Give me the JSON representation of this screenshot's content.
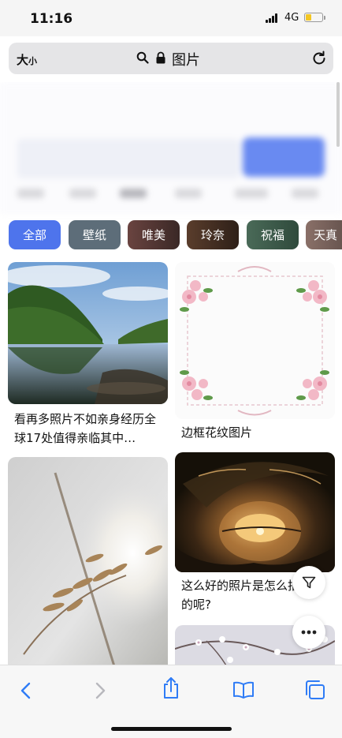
{
  "status_bar": {
    "time": "11:16",
    "network": "4G",
    "battery_level": 0.3
  },
  "url_bar": {
    "text_size_big": "大",
    "text_size_small": "小",
    "url": "图片"
  },
  "categories": [
    {
      "label": "全部",
      "selected": true,
      "color": "#4e74ec"
    },
    {
      "label": "壁纸",
      "selected": false,
      "color": "#5d6d79"
    },
    {
      "label": "唯美",
      "selected": false,
      "color": "#5a3a38"
    },
    {
      "label": "玲奈",
      "selected": false,
      "color": "#4a3326"
    },
    {
      "label": "祝福",
      "selected": false,
      "color": "#3f5a4a"
    },
    {
      "label": "天真",
      "selected": false,
      "color": "#6b5a55"
    }
  ],
  "feed": [
    {
      "title": "看再多照片不如亲身经历全球17处值得亲临其中…",
      "image": "river-landscape"
    },
    {
      "title": "边框花纹图片",
      "image": "floral-border"
    },
    {
      "title": "",
      "image": "wheat-sunlight"
    },
    {
      "title": "这么好的照片是怎么拍的呢?",
      "image": "wave-sunset"
    },
    {
      "title": "",
      "image": "blossom-branch"
    }
  ],
  "icons": {
    "filter": "filter-icon",
    "more": "more-icon",
    "back": "back-icon",
    "forward": "forward-icon",
    "share": "share-icon",
    "bookmarks": "bookmarks-icon",
    "tabs": "tabs-icon"
  },
  "colors": {
    "accent": "#4e74ec",
    "toolbar_icon": "#2f7cf6"
  }
}
